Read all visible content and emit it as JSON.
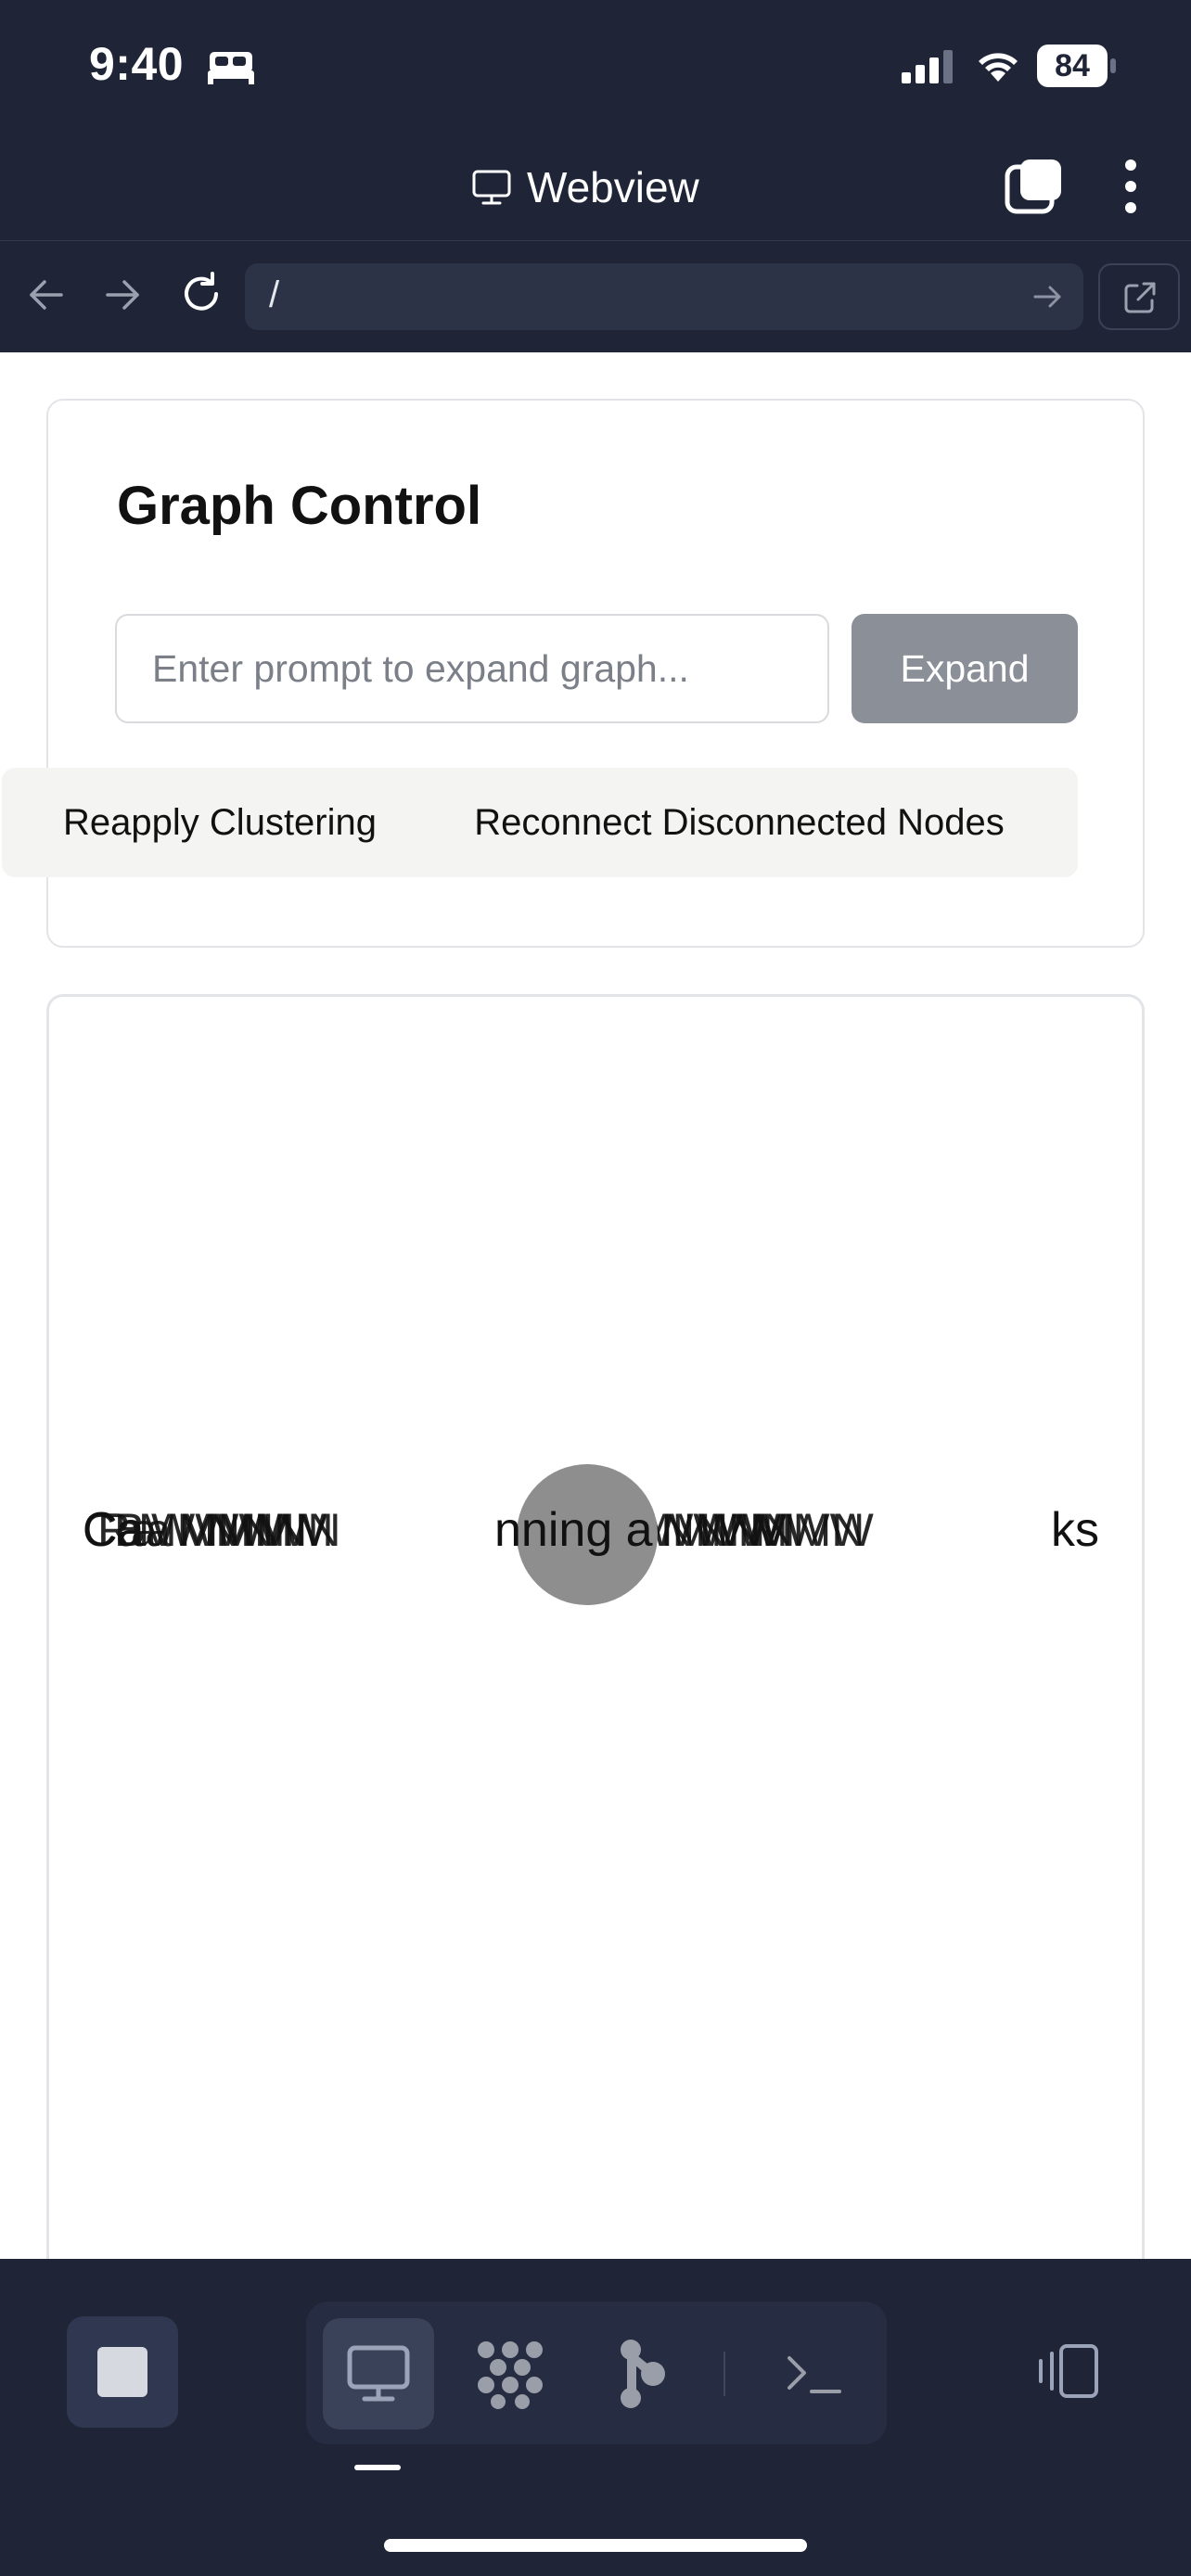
{
  "status_bar": {
    "time": "9:40",
    "battery": "84",
    "icons": [
      "bed-icon",
      "cellular-signal-icon",
      "wifi-icon",
      "battery-icon"
    ]
  },
  "header": {
    "title": "Webview",
    "title_icon": "monitor-icon",
    "actions": [
      "tabs-icon",
      "more-vertical-icon"
    ]
  },
  "browser_bar": {
    "url": "/",
    "back_icon": "arrow-left-icon",
    "forward_icon": "arrow-right-icon",
    "reload_icon": "reload-icon",
    "go_icon": "arrow-right-icon",
    "open_external_icon": "external-link-icon"
  },
  "graph_control": {
    "title": "Graph Control",
    "prompt_placeholder": "Enter prompt to expand graph...",
    "expand_label": "Expand",
    "cluster_label": "Reapply Clustering",
    "reconnect_label": "Reconnect Disconnected Nodes"
  },
  "graph": {
    "center_label": "nning a",
    "left_label_fragment": "Ca",
    "right_label_fragment": "ks",
    "node_color": "#8e8e8e"
  },
  "bottom_bar": {
    "stop_icon": "stop-icon",
    "modes": [
      "monitor-icon",
      "grid-dots-icon",
      "graph-icon",
      "terminal-icon"
    ],
    "active_mode": "monitor-icon",
    "rotate_icon": "rotate-device-icon"
  },
  "colors": {
    "chrome_bg": "#1f2537",
    "url_field_bg": "#2c3347",
    "expand_btn_bg": "#8a8f98",
    "secondary_btn_bg": "#f4f4f2"
  }
}
